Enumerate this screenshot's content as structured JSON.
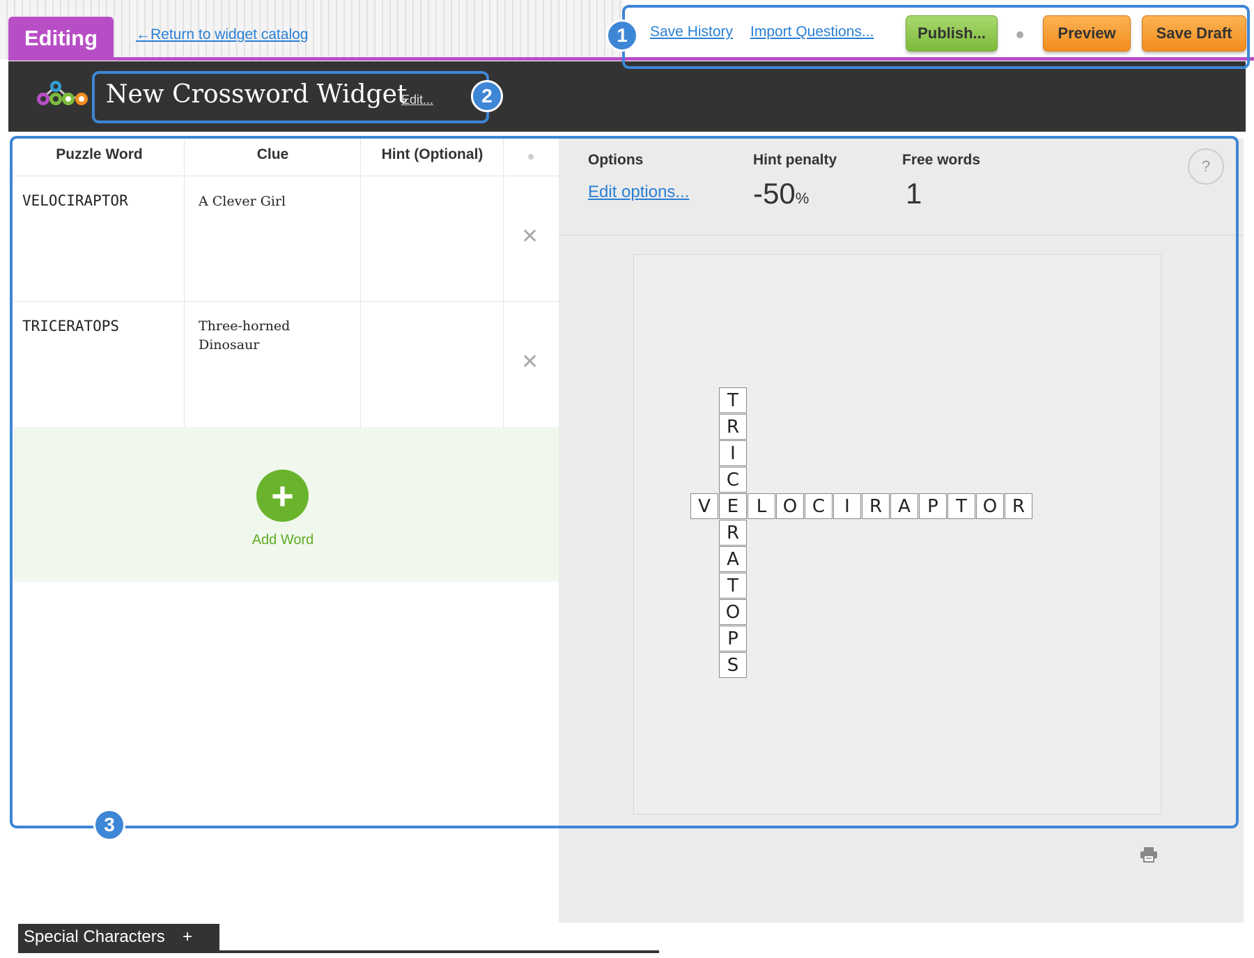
{
  "topbar": {
    "mode_tab": "Editing",
    "return_link": "←Return to widget catalog",
    "save_history": "Save History",
    "import_questions": "Import Questions...",
    "publish": "Publish...",
    "preview": "Preview",
    "save_draft": "Save Draft"
  },
  "header": {
    "title": "New Crossword Widget",
    "edit_link": "Edit..."
  },
  "table": {
    "columns": [
      "Puzzle Word",
      "Clue",
      "Hint (Optional)"
    ],
    "rows": [
      {
        "word": "VELOCIRAPTOR",
        "clue": "A Clever Girl",
        "hint": ""
      },
      {
        "word": "TRICERATOPS",
        "clue": "Three-horned Dinosaur",
        "hint": ""
      }
    ],
    "add_word": "Add Word"
  },
  "options": {
    "options_label": "Options",
    "edit_options": "Edit options...",
    "hint_penalty_label": "Hint penalty",
    "hint_penalty_value": "-50",
    "hint_penalty_unit": "%",
    "free_words_label": "Free words",
    "free_words_value": "1",
    "help": "?"
  },
  "crossword": {
    "across_word": "VELOCIRAPTOR",
    "down_word": "TRICERATOPS"
  },
  "footer": {
    "special_characters": "Special Characters",
    "expand": "+"
  },
  "annotations": [
    "1",
    "2",
    "3"
  ],
  "colors": {
    "accent_purple": "#b84ec6",
    "link_blue": "#2a7fd4",
    "publish_green": "#7dbb3c",
    "orange": "#f28d1e",
    "callout_blue": "#3e86d6"
  }
}
